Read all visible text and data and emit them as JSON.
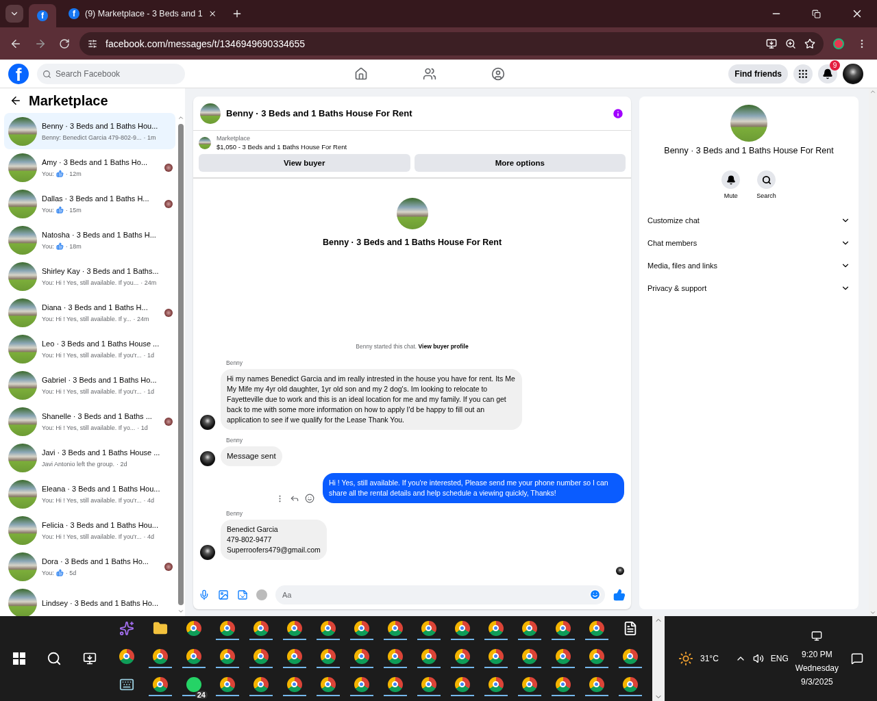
{
  "browser": {
    "pinned_tab_icon": "f",
    "tab_icon": "f",
    "tab_title": "(9) Marketplace - 3 Beds and 1",
    "url": "facebook.com/messages/t/1346949690334655"
  },
  "header": {
    "logo": "f",
    "search_placeholder": "Search Facebook",
    "find_friends": "Find friends",
    "notification_count": "9"
  },
  "sidebar": {
    "title": "Marketplace",
    "conversations": [
      {
        "title": "Benny · 3 Beds and 1 Baths Hou...",
        "preview": "Benny: Benedict Garcia 479-802-9...",
        "like": false,
        "time": "· 1m",
        "selected": true,
        "seen": false
      },
      {
        "title": "Amy · 3 Beds and 1 Baths Ho...",
        "preview": "You:",
        "like": true,
        "time": "· 12m",
        "selected": false,
        "seen": true
      },
      {
        "title": "Dallas · 3 Beds and 1 Baths H...",
        "preview": "You:",
        "like": true,
        "time": "· 15m",
        "selected": false,
        "seen": true
      },
      {
        "title": "Natosha · 3 Beds and 1 Baths H...",
        "preview": "You:",
        "like": true,
        "time": "· 18m",
        "selected": false,
        "seen": false
      },
      {
        "title": "Shirley Kay · 3 Beds and 1 Baths...",
        "preview": "You: Hi ! Yes, still available. If you...",
        "like": false,
        "time": "· 24m",
        "selected": false,
        "seen": false
      },
      {
        "title": "Diana · 3 Beds and 1 Baths H...",
        "preview": "You: Hi ! Yes, still available. If y...",
        "like": false,
        "time": "· 24m",
        "selected": false,
        "seen": true
      },
      {
        "title": "Leo · 3 Beds and 1 Baths House ...",
        "preview": "You: Hi ! Yes, still available. If you'r...",
        "like": false,
        "time": "· 1d",
        "selected": false,
        "seen": false
      },
      {
        "title": "Gabriel · 3 Beds and 1 Baths Ho...",
        "preview": "You: Hi ! Yes, still available. If you'r...",
        "like": false,
        "time": "· 1d",
        "selected": false,
        "seen": false
      },
      {
        "title": "Shanelle · 3 Beds and 1 Baths ...",
        "preview": "You: Hi ! Yes, still available. If yo...",
        "like": false,
        "time": "· 1d",
        "selected": false,
        "seen": true
      },
      {
        "title": "Javi · 3 Beds and 1 Baths House ...",
        "preview": "Javi Antonio left the group.",
        "like": false,
        "time": "· 2d",
        "selected": false,
        "seen": false
      },
      {
        "title": "Eleana · 3 Beds and 1 Baths Hou...",
        "preview": "You: Hi ! Yes, still available. If you'r...",
        "like": false,
        "time": "· 4d",
        "selected": false,
        "seen": false
      },
      {
        "title": "Felicia · 3 Beds and 1 Baths Hou...",
        "preview": "You: Hi ! Yes, still available. If you'r...",
        "like": false,
        "time": "· 4d",
        "selected": false,
        "seen": false
      },
      {
        "title": "Dora · 3 Beds and 1 Baths Ho...",
        "preview": "You:",
        "like": true,
        "time": "· 5d",
        "selected": false,
        "seen": true
      },
      {
        "title": "Lindsey · 3 Beds and 1 Baths Ho...",
        "selected": false,
        "seen": false
      }
    ]
  },
  "chat": {
    "title": "Benny · 3 Beds and 1 Baths House For Rent",
    "listing_label": "Marketplace",
    "listing": "$1,050 - 3 Beds and 1 Baths House For Rent",
    "buttons": [
      "View buyer",
      "More options"
    ],
    "intro_title": "Benny · 3 Beds and 1 Baths House For Rent",
    "notice": "Benny started this chat.",
    "notice_link": "View buyer profile",
    "messages": [
      {
        "kind": "incoming",
        "sender": "Benny",
        "text": "Hi my names Benedict Garcia and im really intrested in the house you have for rent. Its Me My Mife my 4yr old daughter, 1yr old son and my 2 dog's. Im looking to relocate to Fayetteville due to work and this is an ideal location for me and my family.  If you can get back to me with some more information on how to apply I'd be happy to fill out an application to see if we qualify for the Lease Thank You."
      },
      {
        "kind": "incoming",
        "sender": "Benny",
        "text": "Message sent",
        "large": true
      },
      {
        "kind": "outgoing",
        "text": "Hi ! Yes, still available. If you're interested, Please send me your phone number so I can share all the rental details and help schedule a viewing quickly, Thanks!"
      },
      {
        "kind": "incoming",
        "sender": "Benny",
        "text": "Benedict Garcia\n479-802-9477\nSuperroofers479@gmail.com"
      }
    ],
    "composer_placeholder": "Aa"
  },
  "details": {
    "title": "Benny · 3 Beds and 1 Baths House For Rent",
    "actions": [
      {
        "kind": "mute",
        "label": "Mute"
      },
      {
        "kind": "search",
        "label": "Search"
      }
    ],
    "sections": [
      {
        "label": "Customize chat",
        "expanded": false
      },
      {
        "label": "Chat members",
        "expanded": false
      },
      {
        "label": "Media, files and links",
        "expanded": false
      },
      {
        "label": "Privacy & support",
        "expanded": false
      }
    ]
  },
  "taskbar": {
    "weather": "31°C",
    "language": "ENG",
    "time": "9:20 PM",
    "day": "Wednesday",
    "date": "9/3/2025",
    "rows": [
      [
        {
          "kind": "copilot",
          "running": false
        },
        {
          "kind": "folder",
          "running": false
        },
        {
          "kind": "chrome",
          "running": false
        },
        {
          "kind": "chrome",
          "running": true
        },
        {
          "kind": "chrome",
          "running": true
        },
        {
          "kind": "chrome",
          "running": true
        },
        {
          "kind": "chrome",
          "running": true
        },
        {
          "kind": "chrome",
          "running": true
        },
        {
          "kind": "chrome",
          "running": true
        },
        {
          "kind": "chrome",
          "running": true
        },
        {
          "kind": "chrome",
          "running": true
        },
        {
          "kind": "chrome",
          "running": true
        },
        {
          "kind": "chrome",
          "running": true
        },
        {
          "kind": "chrome",
          "running": true
        },
        {
          "kind": "chrome",
          "running": true
        },
        {
          "kind": "file",
          "running": false
        }
      ],
      [
        {
          "kind": "chrome",
          "running": false
        },
        {
          "kind": "chrome",
          "running": true
        },
        {
          "kind": "chrome",
          "running": true
        },
        {
          "kind": "chrome",
          "running": true
        },
        {
          "kind": "chrome",
          "running": true
        },
        {
          "kind": "chrome",
          "running": true
        },
        {
          "kind": "chrome",
          "running": true
        },
        {
          "kind": "chrome",
          "running": true
        },
        {
          "kind": "chrome",
          "running": true
        },
        {
          "kind": "chrome",
          "running": true
        },
        {
          "kind": "chrome",
          "running": true
        },
        {
          "kind": "chrome",
          "running": true
        },
        {
          "kind": "chrome",
          "running": true
        },
        {
          "kind": "chrome",
          "running": true
        },
        {
          "kind": "chrome",
          "running": true
        },
        {
          "kind": "chrome",
          "running": true
        }
      ],
      [
        {
          "kind": "keyboard",
          "running": false
        },
        {
          "kind": "chrome",
          "running": true
        },
        {
          "kind": "whatsapp",
          "running": true,
          "badge": "24"
        },
        {
          "kind": "chrome",
          "running": true
        },
        {
          "kind": "chrome",
          "running": true
        },
        {
          "kind": "chrome",
          "running": true
        },
        {
          "kind": "chrome",
          "running": true
        },
        {
          "kind": "chrome",
          "running": true
        },
        {
          "kind": "chrome",
          "running": true
        },
        {
          "kind": "chrome",
          "running": true
        },
        {
          "kind": "chrome",
          "running": true
        },
        {
          "kind": "chrome",
          "running": true
        },
        {
          "kind": "chrome",
          "running": true
        },
        {
          "kind": "chrome",
          "running": true
        },
        {
          "kind": "chrome",
          "running": true
        },
        {
          "kind": "chrome",
          "running": true
        }
      ]
    ]
  }
}
